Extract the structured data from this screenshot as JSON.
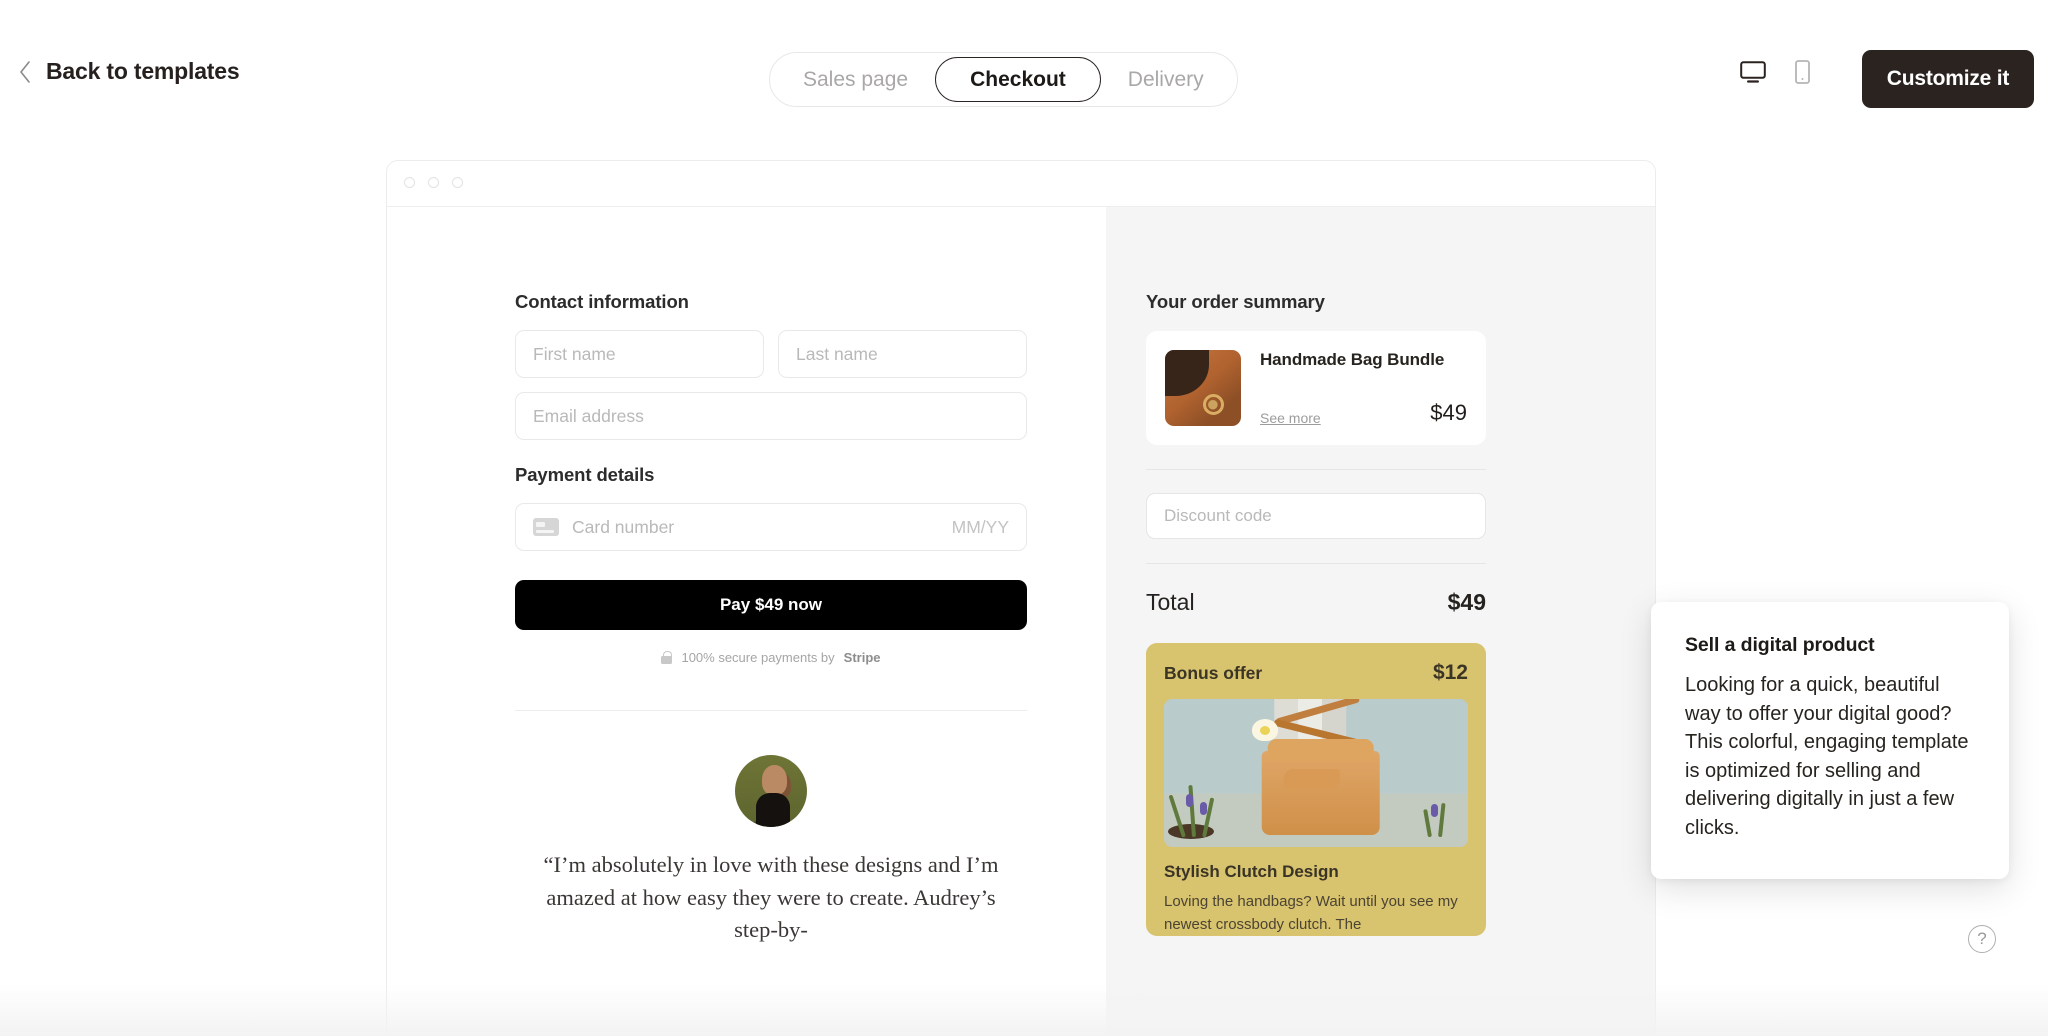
{
  "topbar": {
    "back_label": "Back to templates",
    "back_icon": "chevron-left-icon",
    "tabs": [
      {
        "label": "Sales page",
        "active": false
      },
      {
        "label": "Checkout",
        "active": true
      },
      {
        "label": "Delivery",
        "active": false
      }
    ],
    "desktop_icon": "desktop-monitor-icon",
    "mobile_icon": "mobile-phone-icon",
    "customize_label": "Customize it"
  },
  "preview": {
    "chrome_dots": 3,
    "checkout": {
      "contact_title": "Contact information",
      "first_name_placeholder": "First name",
      "last_name_placeholder": "Last name",
      "email_placeholder": "Email address",
      "payment_title": "Payment details",
      "card_placeholder": "Card number",
      "card_expiry_placeholder": "MM/YY",
      "card_icon": "credit-card-icon",
      "pay_button_label": "Pay $49 now",
      "secure_icon": "lock-icon",
      "secure_text": "100% secure payments by ",
      "secure_brand": "Stripe",
      "testimonial_quote": "“I’m absolutely in love with these designs and I’m amazed at how easy they were to create. Audrey’s step-by-"
    },
    "summary": {
      "title": "Your order summary",
      "product_name": "Handmade Bag Bundle",
      "see_more_label": "See more",
      "product_price": "$49",
      "discount_placeholder": "Discount code",
      "total_label": "Total",
      "total_value": "$49",
      "bonus_label": "Bonus offer",
      "bonus_price": "$12",
      "bonus_name": "Stylish Clutch Design",
      "bonus_desc": "Loving the handbags? Wait until you see my newest crossbody clutch. The"
    }
  },
  "tooltip": {
    "title": "Sell a digital product",
    "body": "Looking for a quick, beautiful way to offer your digital good? This colorful, engaging template is optimized for selling and delivering digitally in just a few clicks."
  },
  "help": {
    "icon": "question-mark-circle-icon",
    "label": "?"
  },
  "colors": {
    "accent_dark": "#2b2320",
    "pay_button": "#000000",
    "bonus_card": "#d8c36e",
    "summary_bg": "#f5f5f5"
  }
}
